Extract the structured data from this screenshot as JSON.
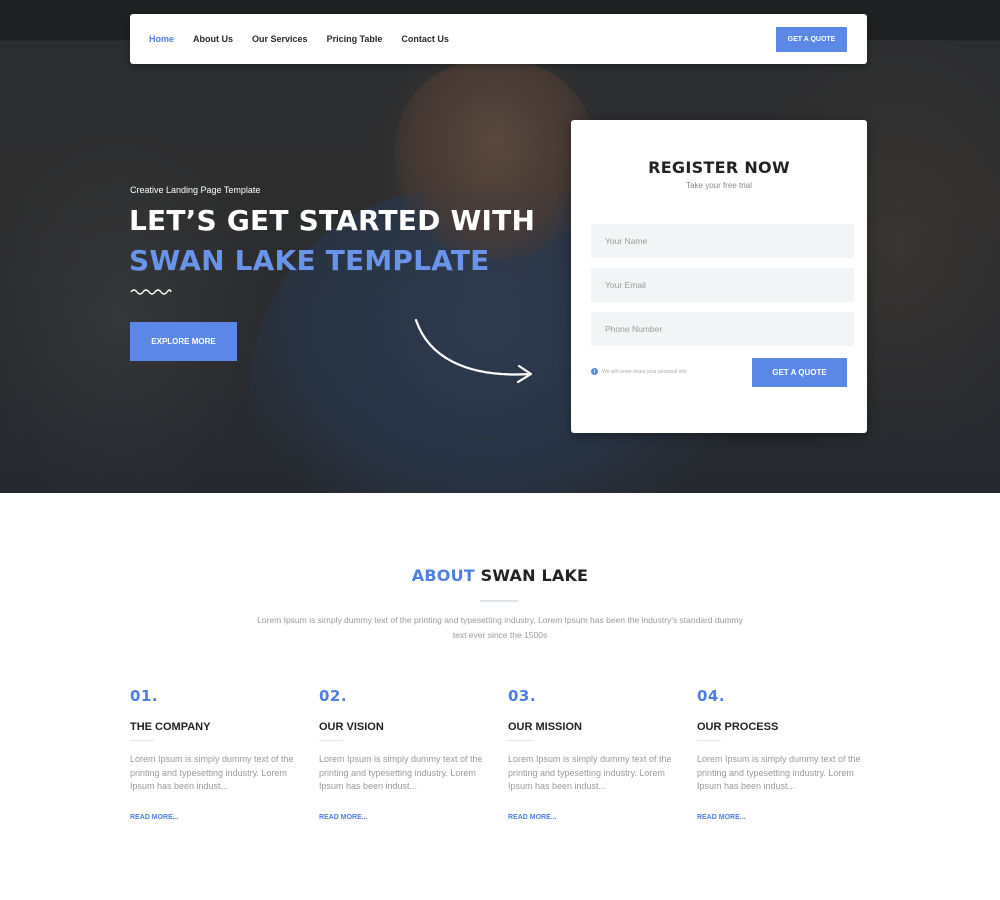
{
  "nav": {
    "items": [
      {
        "label": "Home",
        "active": true
      },
      {
        "label": "About Us",
        "active": false
      },
      {
        "label": "Our Services",
        "active": false
      },
      {
        "label": "Pricing Table",
        "active": false
      },
      {
        "label": "Contact Us",
        "active": false
      }
    ],
    "cta_label": "GET A QUOTE"
  },
  "hero": {
    "kicker": "Creative Landing Page Template",
    "headline_line1": "LET’S GET STARTED WITH",
    "headline_line2": "SWAN LAKE TEMPLATE",
    "button_label": "EXPLORE MORE"
  },
  "register": {
    "title": "REGISTER NOW",
    "subtitle": "Take your free trial",
    "name_placeholder": "Your Name",
    "email_placeholder": "Your Email",
    "phone_placeholder": "Phone Number",
    "note": "We will never share your personal info",
    "button_label": "GET A QUOTE"
  },
  "about": {
    "title_accent": "ABOUT",
    "title_rest": "SWAN LAKE",
    "description": "Lorem Ipsum is simply dummy text of the printing and typesetting industry. Lorem Ipsum has been the industry's standard dummy text ever since the 1500s",
    "features": [
      {
        "number": "01.",
        "title": "THE COMPANY",
        "text": "Lorem Ipsum is simply dummy text of the printing and typesetting industry. Lorem Ipsum has been indust...",
        "link": "READ MORE..."
      },
      {
        "number": "02.",
        "title": "OUR VISION",
        "text": "Lorem Ipsum is simply dummy text of the printing and typesetting industry. Lorem Ipsum has been indust...",
        "link": "READ MORE..."
      },
      {
        "number": "03.",
        "title": "OUR MISSION",
        "text": "Lorem Ipsum is simply dummy text of the printing and typesetting industry. Lorem Ipsum has been indust...",
        "link": "READ MORE..."
      },
      {
        "number": "04.",
        "title": "OUR PROCESS",
        "text": "Lorem Ipsum is simply dummy text of the printing and typesetting industry. Lorem Ipsum has been indust...",
        "link": "READ MORE..."
      }
    ]
  },
  "colors": {
    "accent": "#5b87e6",
    "accent_text": "#4f7fe0",
    "hero_highlight": "#6a93ea"
  }
}
